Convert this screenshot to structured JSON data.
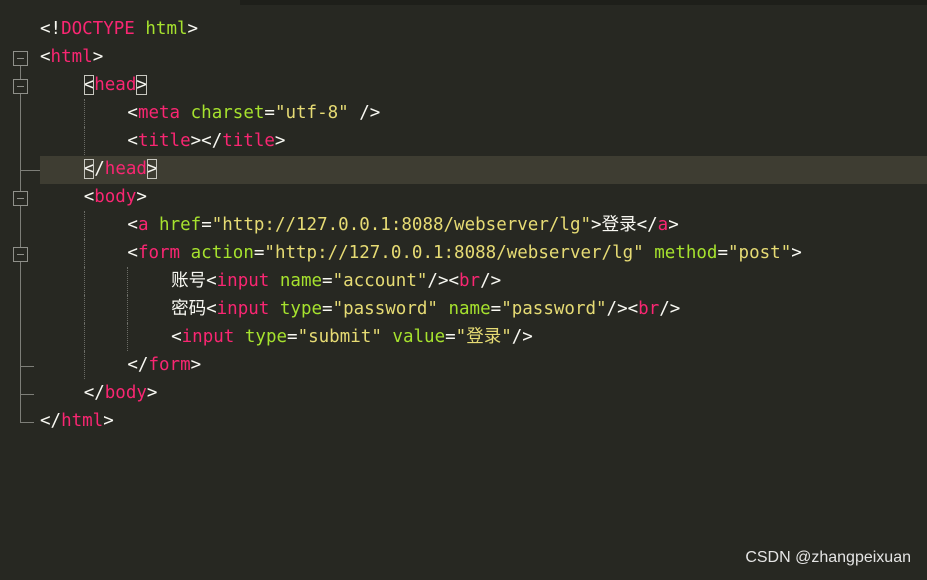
{
  "lines": [
    {
      "indent": 0,
      "segs": [
        {
          "c": "punc",
          "t": "<!"
        },
        {
          "c": "tag-name",
          "t": "DOCTYPE"
        },
        {
          "c": "txt",
          "t": " "
        },
        {
          "c": "attr",
          "t": "html"
        },
        {
          "c": "punc",
          "t": ">"
        }
      ]
    },
    {
      "indent": 0,
      "segs": [
        {
          "c": "punc",
          "t": "<"
        },
        {
          "c": "tag-name",
          "t": "html"
        },
        {
          "c": "punc",
          "t": ">"
        }
      ]
    },
    {
      "indent": 1,
      "segs": [
        {
          "c": "punc",
          "t": "<",
          "box": true
        },
        {
          "c": "tag-name",
          "t": "head"
        },
        {
          "c": "punc",
          "t": ">",
          "box": true
        }
      ]
    },
    {
      "indent": 2,
      "segs": [
        {
          "c": "punc",
          "t": "<"
        },
        {
          "c": "tag-name",
          "t": "meta"
        },
        {
          "c": "txt",
          "t": " "
        },
        {
          "c": "attr",
          "t": "charset"
        },
        {
          "c": "punc",
          "t": "="
        },
        {
          "c": "str",
          "t": "\"utf-8\""
        },
        {
          "c": "txt",
          "t": " "
        },
        {
          "c": "punc",
          "t": "/>"
        }
      ]
    },
    {
      "indent": 2,
      "segs": [
        {
          "c": "punc",
          "t": "<"
        },
        {
          "c": "tag-name",
          "t": "title"
        },
        {
          "c": "punc",
          "t": "></"
        },
        {
          "c": "tag-name",
          "t": "title"
        },
        {
          "c": "punc",
          "t": ">"
        }
      ]
    },
    {
      "indent": 1,
      "segs": [
        {
          "c": "punc",
          "t": "<",
          "box": true
        },
        {
          "c": "punc",
          "t": "/"
        },
        {
          "c": "tag-name",
          "t": "head"
        },
        {
          "c": "punc",
          "t": ">",
          "box": true
        }
      ]
    },
    {
      "indent": 1,
      "segs": [
        {
          "c": "punc",
          "t": "<"
        },
        {
          "c": "tag-name",
          "t": "body"
        },
        {
          "c": "punc",
          "t": ">"
        }
      ]
    },
    {
      "indent": 2,
      "segs": [
        {
          "c": "punc",
          "t": "<"
        },
        {
          "c": "tag-name",
          "t": "a"
        },
        {
          "c": "txt",
          "t": " "
        },
        {
          "c": "attr",
          "t": "href"
        },
        {
          "c": "punc",
          "t": "="
        },
        {
          "c": "str",
          "t": "\"http://127.0.0.1:8088/webserver/lg\""
        },
        {
          "c": "punc",
          "t": ">"
        },
        {
          "c": "txt",
          "t": "登录"
        },
        {
          "c": "punc",
          "t": "</"
        },
        {
          "c": "tag-name",
          "t": "a"
        },
        {
          "c": "punc",
          "t": ">"
        }
      ]
    },
    {
      "indent": 2,
      "segs": [
        {
          "c": "punc",
          "t": "<"
        },
        {
          "c": "tag-name",
          "t": "form"
        },
        {
          "c": "txt",
          "t": " "
        },
        {
          "c": "attr",
          "t": "action"
        },
        {
          "c": "punc",
          "t": "="
        },
        {
          "c": "str",
          "t": "\"http://127.0.0.1:8088/webserver/lg\""
        },
        {
          "c": "txt",
          "t": " "
        },
        {
          "c": "attr",
          "t": "method"
        },
        {
          "c": "punc",
          "t": "="
        },
        {
          "c": "str",
          "t": "\"post\""
        },
        {
          "c": "punc",
          "t": ">"
        }
      ]
    },
    {
      "indent": 3,
      "segs": [
        {
          "c": "txt",
          "t": "账号"
        },
        {
          "c": "punc",
          "t": "<"
        },
        {
          "c": "tag-name",
          "t": "input"
        },
        {
          "c": "txt",
          "t": " "
        },
        {
          "c": "attr",
          "t": "name"
        },
        {
          "c": "punc",
          "t": "="
        },
        {
          "c": "str",
          "t": "\"account\""
        },
        {
          "c": "punc",
          "t": "/><"
        },
        {
          "c": "tag-name",
          "t": "br"
        },
        {
          "c": "punc",
          "t": "/>"
        }
      ]
    },
    {
      "indent": 3,
      "segs": [
        {
          "c": "txt",
          "t": "密码"
        },
        {
          "c": "punc",
          "t": "<"
        },
        {
          "c": "tag-name",
          "t": "input"
        },
        {
          "c": "txt",
          "t": " "
        },
        {
          "c": "attr",
          "t": "type"
        },
        {
          "c": "punc",
          "t": "="
        },
        {
          "c": "str",
          "t": "\"password\""
        },
        {
          "c": "txt",
          "t": " "
        },
        {
          "c": "attr",
          "t": "name"
        },
        {
          "c": "punc",
          "t": "="
        },
        {
          "c": "str",
          "t": "\"password\""
        },
        {
          "c": "punc",
          "t": "/><"
        },
        {
          "c": "tag-name",
          "t": "br"
        },
        {
          "c": "punc",
          "t": "/>"
        }
      ]
    },
    {
      "indent": 3,
      "segs": [
        {
          "c": "punc",
          "t": "<"
        },
        {
          "c": "tag-name",
          "t": "input"
        },
        {
          "c": "txt",
          "t": " "
        },
        {
          "c": "attr",
          "t": "type"
        },
        {
          "c": "punc",
          "t": "="
        },
        {
          "c": "str",
          "t": "\"submit\""
        },
        {
          "c": "txt",
          "t": " "
        },
        {
          "c": "attr",
          "t": "value"
        },
        {
          "c": "punc",
          "t": "="
        },
        {
          "c": "str",
          "t": "\"登录\""
        },
        {
          "c": "punc",
          "t": "/>"
        }
      ]
    },
    {
      "indent": 2,
      "segs": [
        {
          "c": "punc",
          "t": "</"
        },
        {
          "c": "tag-name",
          "t": "form"
        },
        {
          "c": "punc",
          "t": ">"
        }
      ]
    },
    {
      "indent": 1,
      "segs": [
        {
          "c": "punc",
          "t": "</"
        },
        {
          "c": "tag-name",
          "t": "body"
        },
        {
          "c": "punc",
          "t": ">"
        }
      ]
    },
    {
      "indent": 0,
      "segs": [
        {
          "c": "punc",
          "t": "</"
        },
        {
          "c": "tag-name",
          "t": "html"
        },
        {
          "c": "punc",
          "t": ">"
        }
      ]
    }
  ],
  "colors": {
    "background": "#272822",
    "current_line": "#3e3d32",
    "tag": "#F92672",
    "attribute": "#A6E22E",
    "string": "#E6DB74",
    "text": "#F8F8F2"
  },
  "watermark": "CSDN @zhangpeixuan"
}
